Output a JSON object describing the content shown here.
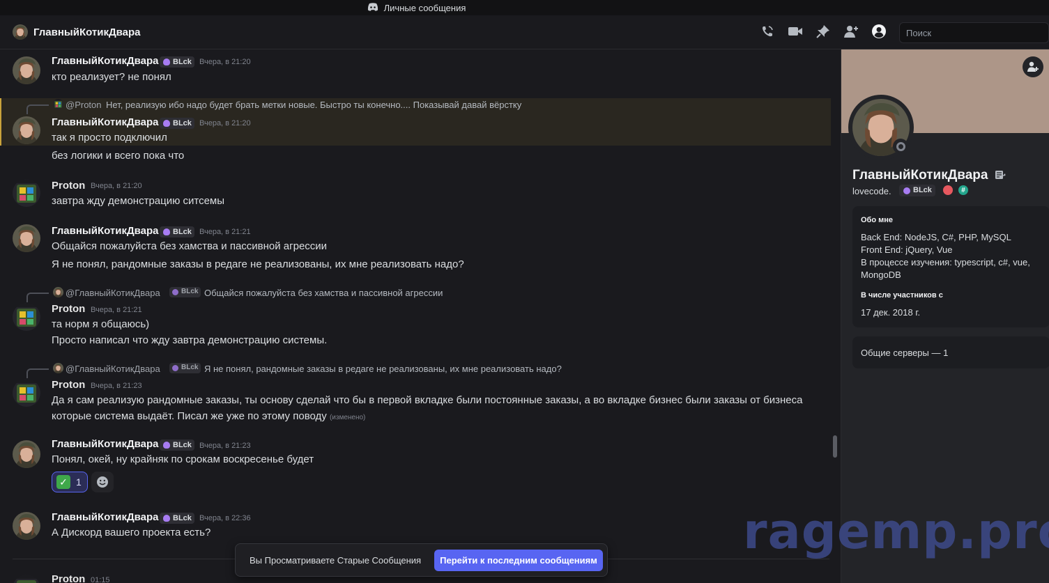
{
  "titlebar": {
    "title": "Личные сообщения"
  },
  "header": {
    "channel_name": "ГлавныйКотикДвара",
    "search_placeholder": "Поиск"
  },
  "messages": [
    {
      "author": "ГлавныйКотикДвара",
      "tag": "BLck",
      "time": "Вчера, в 21:20",
      "lines": [
        "кто реализует? не понял"
      ]
    },
    {
      "reply": {
        "author": "@Proton",
        "text": "Нет, реализую ибо надо будет брать метки новые. Быстро ты конечно.... Показывай давай вёрстку"
      },
      "author": "ГлавныйКотикДвара",
      "tag": "BLck",
      "time": "Вчера, в 21:20",
      "lines": [
        "так я просто подключил",
        "без логики и всего пока что"
      ]
    },
    {
      "author": "Proton",
      "time": "Вчера, в 21:20",
      "lines": [
        "завтра жду демонстрацию ситсемы"
      ]
    },
    {
      "author": "ГлавныйКотикДвара",
      "tag": "BLck",
      "time": "Вчера, в 21:21",
      "lines": [
        "Общайся пожалуйста без хамства и пассивной агрессии",
        "Я не понял, рандомные заказы в редаге не реализованы, их мне реализовать надо?"
      ]
    },
    {
      "reply": {
        "author": "@ГлавныйКотикДвара",
        "tag": "BLck",
        "text": "Общайся пожалуйста без хамства и пассивной агрессии"
      },
      "author": "Proton",
      "time": "Вчера, в 21:21",
      "lines": [
        "та норм я общаюсь)",
        "Просто написал что жду завтра демонстрацию системы."
      ]
    },
    {
      "reply": {
        "author": "@ГлавныйКотикДвара",
        "tag": "BLck",
        "text": "Я не понял, рандомные заказы в редаге не реализованы, их мне реализовать надо?"
      },
      "author": "Proton",
      "time": "Вчера, в 21:23",
      "lines": [
        "Да я сам реализую рандомные заказы, ты основу сделай что бы в первой вкладке были постоянные заказы, а во вкладке бизнес были заказы от бизнеса",
        "которые система выдаёт. Писал же уже по этому поводу"
      ],
      "edited": "(изменено)"
    },
    {
      "author": "ГлавныйКотикДвара",
      "tag": "BLck",
      "time": "Вчера, в 21:23",
      "lines": [
        "Понял, окей, ну крайняк по срокам воскресенье будет"
      ],
      "reaction": {
        "count": "1"
      }
    },
    {
      "author": "ГлавныйКотикДвара",
      "tag": "BLck",
      "time": "Вчера, в 22:36",
      "lines": [
        "А Дискорд вашего проекта есть?"
      ]
    },
    {
      "author": "Proton",
      "time": "01:15"
    }
  ],
  "banner": {
    "text": "Вы Просматриваете Старые Сообщения",
    "button": "Перейти к последним сообщениям"
  },
  "profile": {
    "display_name": "ГлавныйКотикДвара",
    "username": "lovecode.",
    "tag": "BLck",
    "about_label": "Обо мне",
    "about_lines": [
      "Back End: NodeJS, C#, PHP, MySQL",
      "Front End: jQuery, Vue",
      "В процессе изучения: typescript, c#, vue,",
      "MongoDB"
    ],
    "member_since_label": "В числе участников с",
    "member_since": "17 дек. 2018 г.",
    "mutual_servers": "Общие серверы — 1"
  },
  "watermark": "ragemp.pro",
  "colors": {
    "accent": "#5865f2",
    "highlight": "#c9a33c",
    "status_offline": "#80848e"
  }
}
